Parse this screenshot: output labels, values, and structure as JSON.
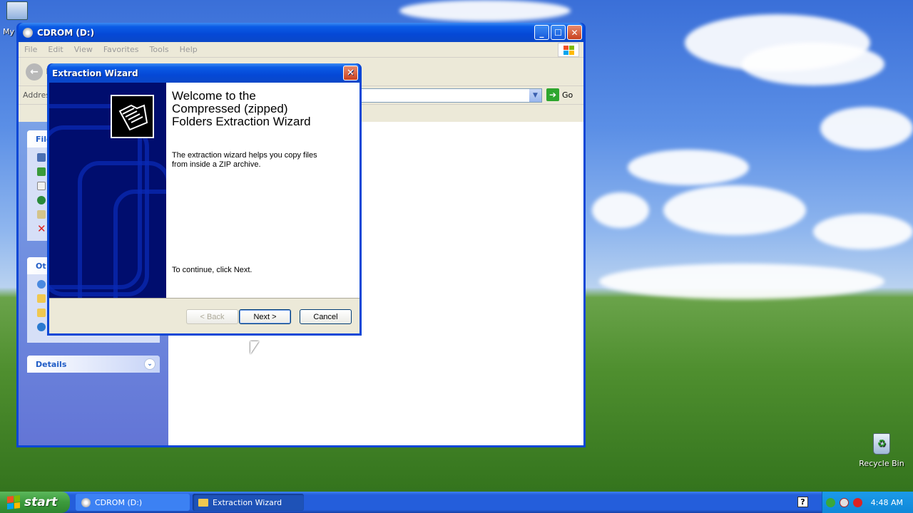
{
  "desktop": {
    "my_icon_label": "My",
    "recycle_bin_label": "Recycle Bin"
  },
  "explorer": {
    "title": "CDROM (D:)",
    "menu": [
      "File",
      "Edit",
      "View",
      "Favorites",
      "Tools",
      "Help"
    ],
    "back_label": "B",
    "address_label": "Address",
    "go_label": "Go",
    "file_tasks_heading": "File",
    "other_places_heading": "Ot",
    "details_heading": "Details"
  },
  "wizard": {
    "title": "Extraction Wizard",
    "heading": "Welcome to the Compressed (zipped) Folders Extraction Wizard",
    "description": "The extraction wizard helps you copy files from inside a ZIP archive.",
    "continue_text": "To continue, click Next.",
    "back_button": "< Back",
    "next_button": "Next >",
    "cancel_button": "Cancel"
  },
  "taskbar": {
    "start_label": "start",
    "items": [
      {
        "label": "CDROM (D:)",
        "active": false
      },
      {
        "label": "Extraction Wizard",
        "active": true
      }
    ],
    "clock": "4:48 AM"
  },
  "colors": {
    "xp_blue": "#0a47d6",
    "taskpane_blue": "#6375d6",
    "start_green": "#3c9a3c"
  }
}
